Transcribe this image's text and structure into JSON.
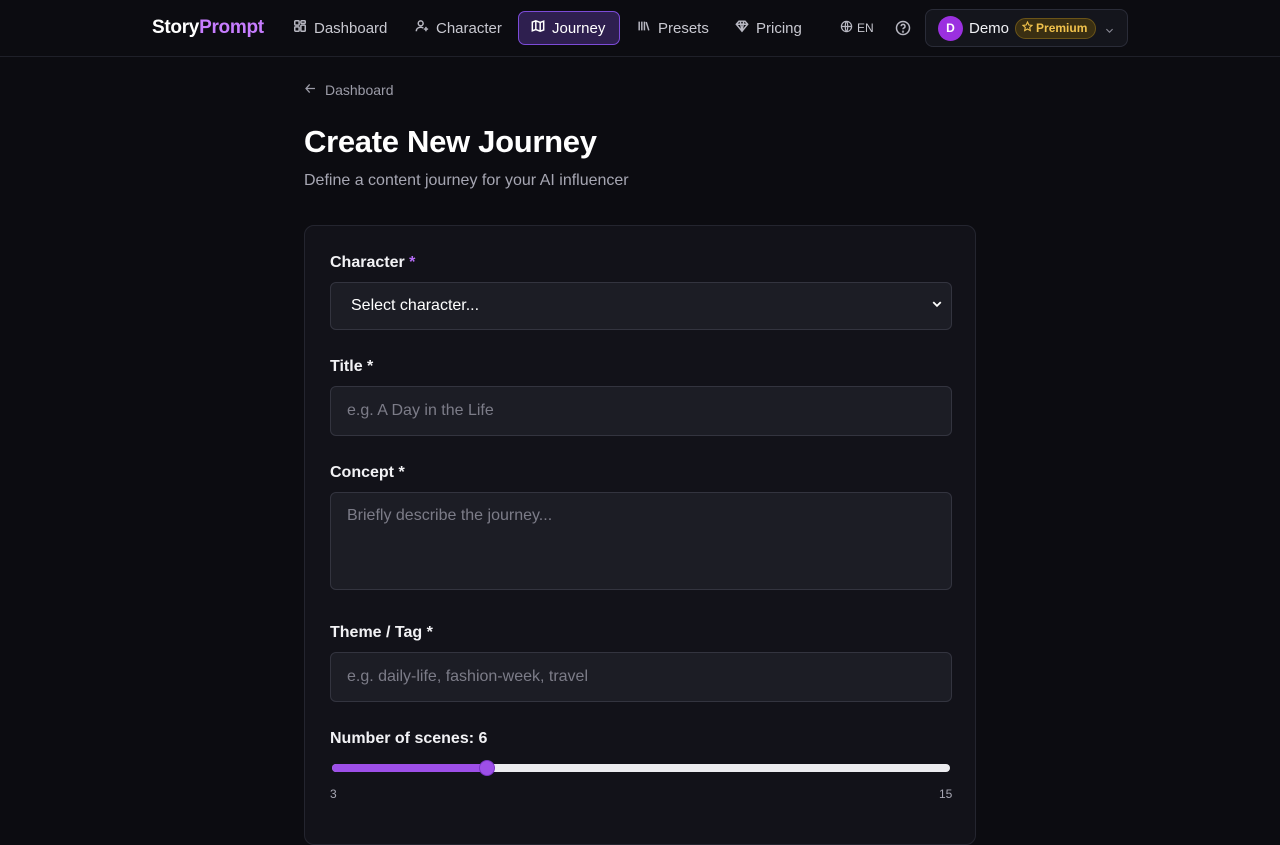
{
  "brand": {
    "part1": "Story",
    "part2": "Prompt"
  },
  "nav": {
    "items": [
      {
        "label": "Dashboard",
        "icon": "grid-icon",
        "active": false
      },
      {
        "label": "Character",
        "icon": "user-plus-icon",
        "active": false
      },
      {
        "label": "Journey",
        "icon": "map-icon",
        "active": true
      },
      {
        "label": "Presets",
        "icon": "library-icon",
        "active": false
      },
      {
        "label": "Pricing",
        "icon": "gem-icon",
        "active": false
      }
    ],
    "language": "EN"
  },
  "user": {
    "initial": "D",
    "name": "Demo",
    "badge": "Premium",
    "avatar_color": "#9b30e0"
  },
  "page": {
    "back_label": "Dashboard",
    "title": "Create New Journey",
    "subtitle": "Define a content journey for your AI influencer"
  },
  "form": {
    "character": {
      "label": "Character",
      "required_mark": "*",
      "value": "Select character..."
    },
    "title": {
      "label": "Title *",
      "placeholder": "e.g. A Day in the Life",
      "value": ""
    },
    "concept": {
      "label": "Concept *",
      "placeholder": "Briefly describe the journey...",
      "value": ""
    },
    "theme": {
      "label": "Theme / Tag *",
      "placeholder": "e.g. daily-life, fashion-week, travel",
      "value": ""
    },
    "scenes": {
      "label": "Number of scenes: 6",
      "value": 6,
      "min": 3,
      "max": 15,
      "min_label": "3",
      "max_label": "15"
    }
  },
  "colors": {
    "accent": "#9d4fe8",
    "background": "#0c0c11",
    "premium": "#f1c24c"
  }
}
